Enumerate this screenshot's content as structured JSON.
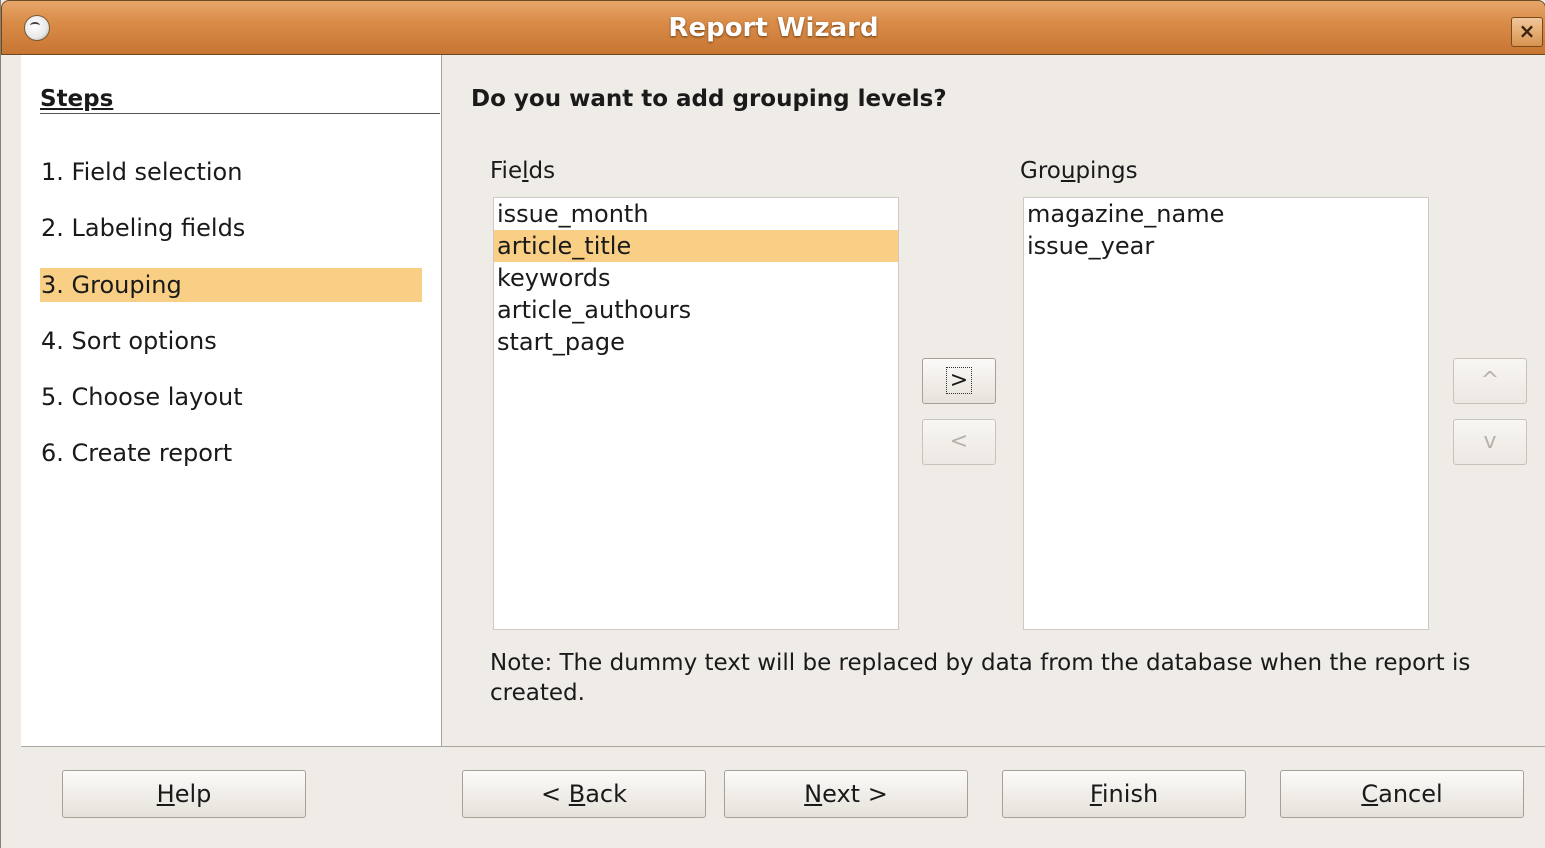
{
  "window": {
    "title": "Report Wizard",
    "close_glyph": "×"
  },
  "steps": {
    "heading": "Steps",
    "items": [
      {
        "label": "1. Field selection"
      },
      {
        "label": "2. Labeling fields"
      },
      {
        "label": "3. Grouping",
        "selected": true
      },
      {
        "label": "4. Sort options"
      },
      {
        "label": "5. Choose layout"
      },
      {
        "label": "6. Create report"
      }
    ]
  },
  "main": {
    "question": "Do you want to add grouping levels?",
    "fields_label_pre": "Fie",
    "fields_label_mn": "l",
    "fields_label_post": "ds",
    "fields": [
      "issue_month",
      "article_title",
      "keywords",
      "article_authours",
      "start_page"
    ],
    "fields_selected": "article_title",
    "groupings_label_pre": "Gro",
    "groupings_label_mn": "u",
    "groupings_label_post": "pings",
    "groupings": [
      "magazine_name",
      "issue_year"
    ],
    "add_glyph": ">",
    "remove_glyph": "<",
    "up_glyph": "^",
    "down_glyph": "v",
    "note": "Note: The dummy text will be replaced by data from the database when the report is created."
  },
  "buttons": {
    "help": {
      "mn": "H",
      "rest": "elp"
    },
    "back": {
      "pre": "< ",
      "mn": "B",
      "rest": "ack"
    },
    "next": {
      "mn": "N",
      "rest": "ext >"
    },
    "finish": {
      "mn": "F",
      "rest": "inish"
    },
    "cancel": {
      "mn": "C",
      "rest": "ancel"
    }
  },
  "colors": {
    "titlebar": "#d98c48",
    "selection": "#f8cf84"
  }
}
